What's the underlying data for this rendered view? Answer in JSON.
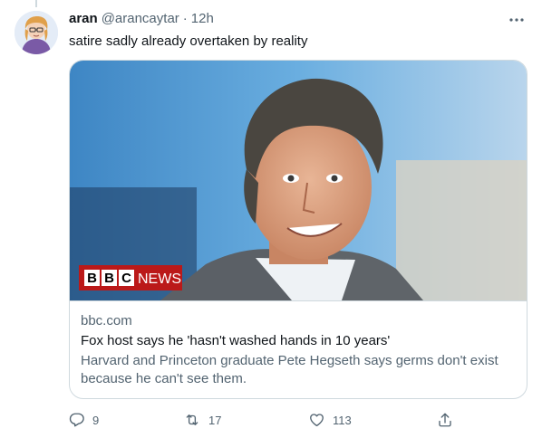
{
  "tweet": {
    "display_name": "aran",
    "handle": "@arancaytar",
    "separator": "·",
    "time": "12h",
    "text": "satire sadly already overtaken by reality",
    "more_icon": "more-horizontal-icon"
  },
  "card": {
    "image_badge": {
      "letters": [
        "B",
        "B",
        "C"
      ],
      "word": "NEWS"
    },
    "domain": "bbc.com",
    "title": "Fox host says he 'hasn't washed hands in 10 years'",
    "description": "Harvard and Princeton graduate Pete Hegseth says germs don't exist because he can't see them."
  },
  "actions": {
    "reply": {
      "icon": "reply-icon",
      "count": "9"
    },
    "retweet": {
      "icon": "retweet-icon",
      "count": "17"
    },
    "like": {
      "icon": "heart-icon",
      "count": "113"
    },
    "share": {
      "icon": "share-icon"
    }
  },
  "colors": {
    "text_primary": "#0f1419",
    "text_secondary": "#536471",
    "border": "#cfd9de",
    "bbc_red": "#bb1919"
  }
}
